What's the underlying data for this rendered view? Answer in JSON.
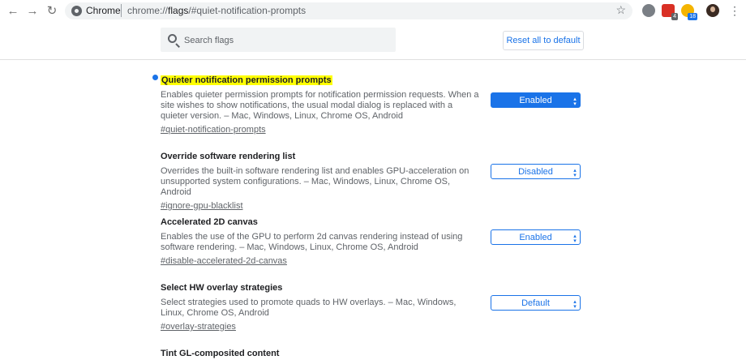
{
  "browser": {
    "back_icon": "arrow-left-icon",
    "forward_icon": "arrow-right-icon",
    "reload_icon": "reload-icon",
    "site_label": "Chrome",
    "url_scheme": "chrome://",
    "url_host": "flags",
    "url_path": "/#quiet-notification-prompts",
    "extensions": [
      {
        "name": "cloud-extension-icon",
        "color": "#5f6368",
        "badge": ""
      },
      {
        "name": "red-extension-icon",
        "color": "#d93025",
        "badge": "4"
      },
      {
        "name": "check-extension-icon",
        "color": "#f4b400",
        "badge": "18"
      }
    ]
  },
  "header": {
    "search_placeholder": "Search flags",
    "reset_label": "Reset all to default"
  },
  "colors": {
    "accent": "#1a73e8",
    "highlight": "#ffff00"
  },
  "flags": [
    {
      "title": "Quieter notification permission prompts",
      "description": "Enables quieter permission prompts for notification permission requests. When a site wishes to show notifications, the usual modal dialog is replaced with a quieter version. – Mac, Windows, Linux, Chrome OS, Android",
      "link": "#quiet-notification-prompts",
      "value": "Enabled"
    },
    {
      "title": "Override software rendering list",
      "description": "Overrides the built-in software rendering list and enables GPU-acceleration on unsupported system configurations. – Mac, Windows, Linux, Chrome OS, Android",
      "link": "#ignore-gpu-blacklist",
      "value": "Disabled"
    },
    {
      "title": "Accelerated 2D canvas",
      "description": "Enables the use of the GPU to perform 2d canvas rendering instead of using software rendering. – Mac, Windows, Linux, Chrome OS, Android",
      "link": "#disable-accelerated-2d-canvas",
      "value": "Enabled"
    },
    {
      "title": "Select HW overlay strategies",
      "description": "Select strategies used to promote quads to HW overlays. – Mac, Windows, Linux, Chrome OS, Android",
      "link": "#overlay-strategies",
      "value": "Default"
    },
    {
      "title": "Tint GL-composited content"
    }
  ]
}
